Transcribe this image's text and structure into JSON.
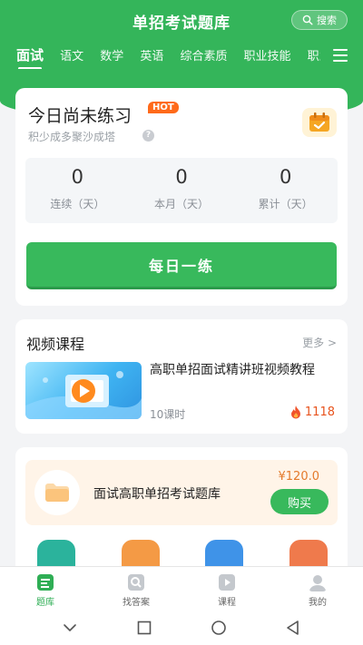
{
  "header": {
    "title": "单招考试题库",
    "search_label": "搜索"
  },
  "tabs": [
    {
      "label": "面试",
      "active": true
    },
    {
      "label": "语文"
    },
    {
      "label": "数学"
    },
    {
      "label": "英语"
    },
    {
      "label": "综合素质"
    },
    {
      "label": "职业技能"
    },
    {
      "label": "职业"
    }
  ],
  "today": {
    "title": "今日尚未练习",
    "hot": "HOT",
    "subtitle": "积少成多聚沙成塔",
    "stats": [
      {
        "value": "0",
        "label": "连续（天）"
      },
      {
        "value": "0",
        "label": "本月（天）"
      },
      {
        "value": "0",
        "label": "累计（天）"
      }
    ],
    "practice_button": "每日一练"
  },
  "video": {
    "section_title": "视频课程",
    "more": "更多 >",
    "course": {
      "name": "高职单招面试精讲班视频教程",
      "lessons": "10课时",
      "views": "1118"
    }
  },
  "bank": {
    "name": "面试高职单招考试题库",
    "price": "¥120.0",
    "buy": "购买"
  },
  "bottom_nav": [
    {
      "label": "题库",
      "icon": "question-bank-icon",
      "active": true
    },
    {
      "label": "找答案",
      "icon": "find-answer-icon"
    },
    {
      "label": "课程",
      "icon": "course-icon"
    },
    {
      "label": "我的",
      "icon": "profile-icon"
    }
  ],
  "colors": {
    "primary": "#34b55a",
    "hot": "#ff6a1a",
    "price": "#e47a2c"
  }
}
